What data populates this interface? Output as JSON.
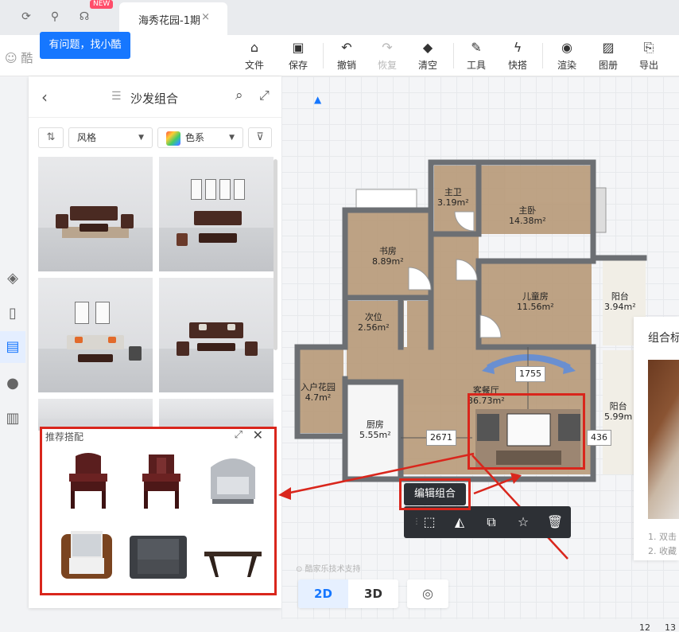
{
  "tabbar": {
    "new_badge": "NEW",
    "tab_title": "海秀花园-1期",
    "tab_close": "×"
  },
  "tooltip": "有问题，找小酷",
  "toolbar": {
    "logo": "酷",
    "items": [
      {
        "label": "文件",
        "icon": "file-icon"
      },
      {
        "label": "保存",
        "icon": "save-icon"
      },
      {
        "label": "撤销",
        "icon": "undo-icon"
      },
      {
        "label": "恢复",
        "icon": "redo-icon",
        "disabled": true
      },
      {
        "label": "清空",
        "icon": "eraser-icon"
      },
      {
        "label": "工具",
        "icon": "wrench-icon"
      },
      {
        "label": "快搭",
        "icon": "lightning-icon"
      },
      {
        "label": "渲染",
        "icon": "render-icon"
      },
      {
        "label": "图册",
        "icon": "album-icon"
      },
      {
        "label": "导出",
        "icon": "export-icon"
      }
    ]
  },
  "panel": {
    "title": "沙发组合",
    "filters": {
      "style_label": "风格",
      "color_label": "色系"
    }
  },
  "recommend": {
    "title": "推荐搭配"
  },
  "floorplan": {
    "rooms": [
      {
        "name": "主卫",
        "area": "3.19m²"
      },
      {
        "name": "主卧",
        "area": "14.38m²"
      },
      {
        "name": "书房",
        "area": "8.89m²"
      },
      {
        "name": "儿童房",
        "area": "11.56m²"
      },
      {
        "name": "阳台",
        "area": "3.94m²"
      },
      {
        "name": "次位",
        "area": "2.56m²"
      },
      {
        "name": "入户花园",
        "area": "4.7m²"
      },
      {
        "name": "厨房",
        "area": "5.55m²"
      },
      {
        "name": "客餐厅",
        "area": "36.73m²"
      },
      {
        "name": "阳台",
        "area": "5.99m"
      }
    ],
    "dims": {
      "d1": "1755",
      "d2": "2671",
      "d3": "436"
    }
  },
  "edit_button": "编辑组合",
  "right_panel": {
    "title": "组合标",
    "note1": "1. 双击",
    "note2": "2. 收藏"
  },
  "view": {
    "btn_2d": "2D",
    "btn_3d": "3D"
  },
  "watermark": "酷家乐技术支持",
  "ruler": {
    "n1": "12",
    "n2": "13"
  },
  "colors": {
    "accent": "#1677ff",
    "highlight": "#d9261c",
    "dark": "#2d3035"
  }
}
